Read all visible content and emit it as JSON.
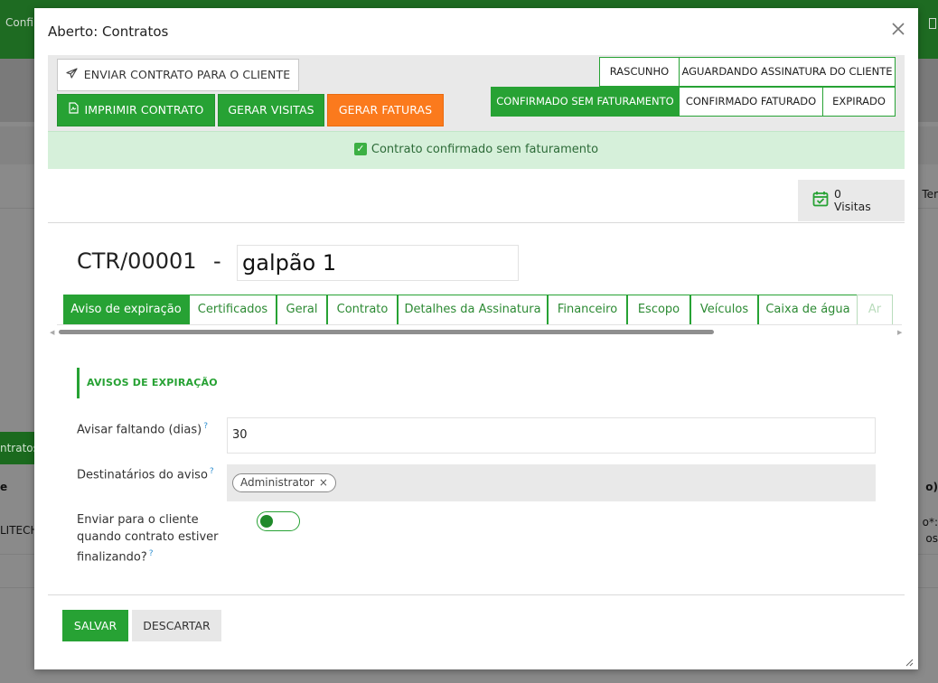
{
  "background": {
    "topbar_text": "Confi",
    "left_tab": "ntratos",
    "left_text_1": "e",
    "left_text_2": "LITECH",
    "right_text_1": "Ter",
    "right_text_2": "o)",
    "right_text_3": "o*:",
    "right_text_4": "os"
  },
  "modal": {
    "title": "Aberto: Contratos",
    "close_icon": "close-icon"
  },
  "actions": {
    "send": "ENVIAR CONTRATO PARA O CLIENTE",
    "print": "IMPRIMIR CONTRATO",
    "visits": "GERAR VISITAS",
    "invoices": "GERAR FATURAS"
  },
  "stages": [
    {
      "label": "RASCUNHO",
      "active": false
    },
    {
      "label": "AGUARDANDO ASSINATURA DO CLIENTE",
      "active": false
    },
    {
      "label": "CONFIRMADO SEM FATURAMENTO",
      "active": true
    },
    {
      "label": "CONFIRMADO FATURADO",
      "active": false
    },
    {
      "label": "EXPIRADO",
      "active": false
    }
  ],
  "alert": {
    "text": "Contrato confirmado sem faturamento",
    "icon": "check-icon"
  },
  "smart_button": {
    "count": "0",
    "label": "Visitas",
    "icon": "calendar-check-icon"
  },
  "record": {
    "reference": "CTR/00001",
    "separator": "-",
    "name": "galpão 1"
  },
  "tabs": [
    {
      "label": "Aviso de expiração",
      "active": true
    },
    {
      "label": "Certificados",
      "active": false
    },
    {
      "label": "Geral",
      "active": false
    },
    {
      "label": "Contrato",
      "active": false
    },
    {
      "label": "Detalhes da Assinatura",
      "active": false
    },
    {
      "label": "Financeiro",
      "active": false
    },
    {
      "label": "Escopo",
      "active": false
    },
    {
      "label": "Veículos",
      "active": false
    },
    {
      "label": "Caixa de água",
      "active": false
    },
    {
      "label": "Ar",
      "active": false
    }
  ],
  "section": {
    "title": "AVISOS DE EXPIRAÇÃO"
  },
  "fields": {
    "days_label": "Avisar faltando (dias)",
    "days_value": "30",
    "recipients_label": "Destinatários do aviso",
    "recipient_chip": "Administrator",
    "chip_remove": "×",
    "send_client_label_1": "Enviar para o cliente",
    "send_client_label_2": "quando contrato estiver",
    "send_client_label_3": "finalizando?",
    "send_client_value": true,
    "help_mark": "?"
  },
  "footer": {
    "save": "SALVAR",
    "discard": "DESCARTAR"
  },
  "colors": {
    "primary": "#27a234",
    "orange": "#fb7a1d",
    "alert_bg": "#d6f0da",
    "topbar": "#1e6b22"
  }
}
